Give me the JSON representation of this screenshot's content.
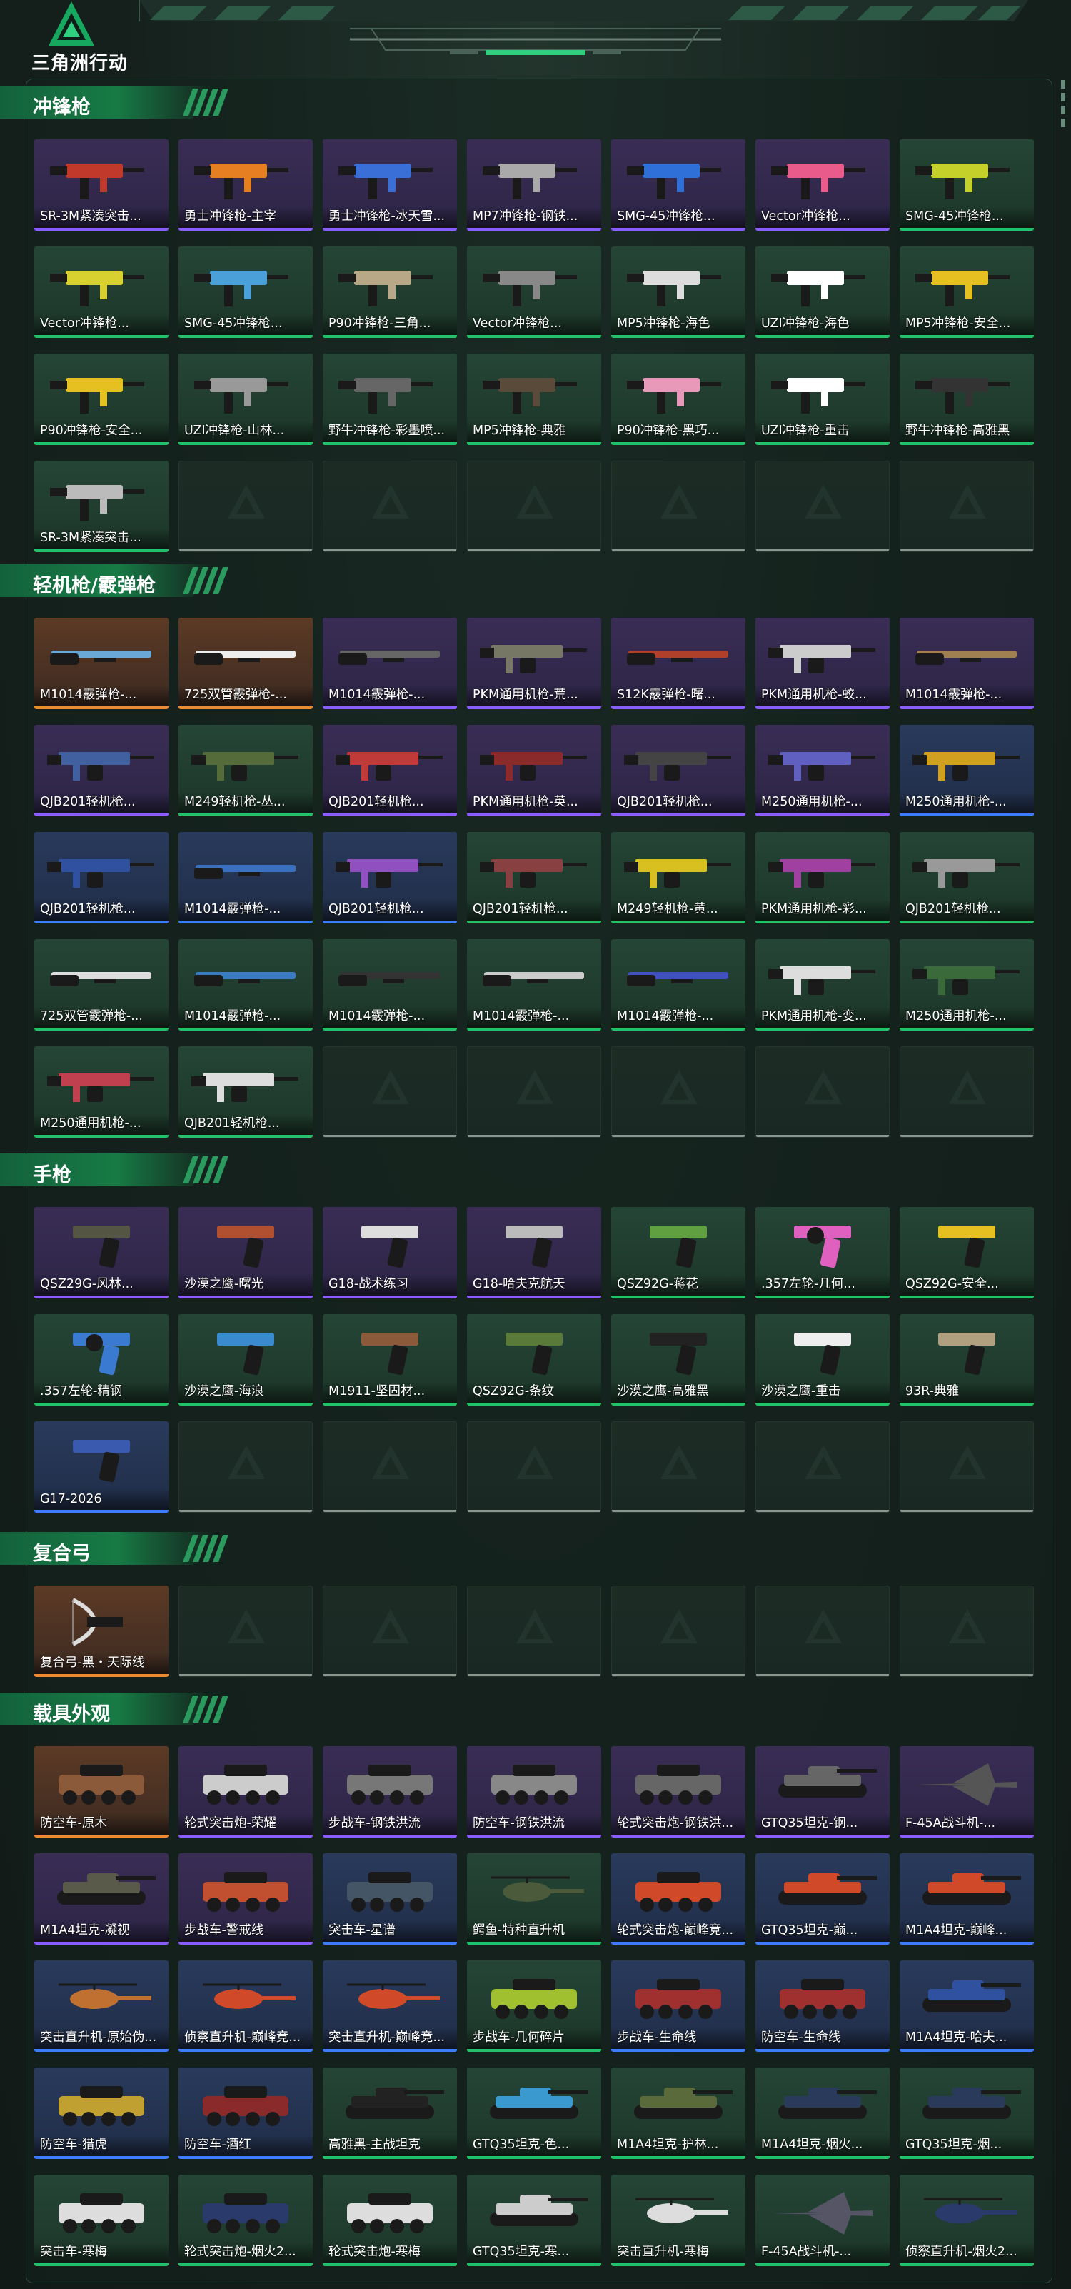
{
  "brand": {
    "name": "三角洲行动",
    "accent": "#22c26a"
  },
  "sections": [
    {
      "title": "冲锋枪",
      "items": [
        {
          "label": "SR-3M紧凑突击...",
          "rarity": "purple",
          "icon": "smg-icon",
          "color": "#c0392b"
        },
        {
          "label": "勇士冲锋枪-主宰",
          "rarity": "purple",
          "icon": "smg-icon",
          "color": "#e67e22"
        },
        {
          "label": "勇士冲锋枪-冰天雪...",
          "rarity": "purple",
          "icon": "smg-icon",
          "color": "#3b6fd8"
        },
        {
          "label": "MP7冲锋枪-钢铁...",
          "rarity": "purple",
          "icon": "smg-icon",
          "color": "#aaaaaa"
        },
        {
          "label": "SMG-45冲锋枪...",
          "rarity": "purple",
          "icon": "smg-icon",
          "color": "#2e6fd8"
        },
        {
          "label": "Vector冲锋枪...",
          "rarity": "purple",
          "icon": "smg-icon",
          "color": "#e85b8a"
        },
        {
          "label": "SMG-45冲锋枪...",
          "rarity": "green",
          "icon": "smg-icon",
          "color": "#c5d02b"
        },
        {
          "label": "Vector冲锋枪...",
          "rarity": "green",
          "icon": "smg-icon",
          "color": "#d8d030"
        },
        {
          "label": "SMG-45冲锋枪...",
          "rarity": "green",
          "icon": "smg-icon",
          "color": "#4aa0d8"
        },
        {
          "label": "P90冲锋枪-三角...",
          "rarity": "green",
          "icon": "smg-icon",
          "color": "#b8a888"
        },
        {
          "label": "Vector冲锋枪...",
          "rarity": "green",
          "icon": "smg-icon",
          "color": "#888888"
        },
        {
          "label": "MP5冲锋枪-海色",
          "rarity": "green",
          "icon": "smg-icon",
          "color": "#dddddd"
        },
        {
          "label": "UZI冲锋枪-海色",
          "rarity": "green",
          "icon": "smg-icon",
          "color": "#ffffff"
        },
        {
          "label": "MP5冲锋枪-安全...",
          "rarity": "green",
          "icon": "smg-icon",
          "color": "#e6c020"
        },
        {
          "label": "P90冲锋枪-安全...",
          "rarity": "green",
          "icon": "smg-icon",
          "color": "#e6c020"
        },
        {
          "label": "UZI冲锋枪-山林...",
          "rarity": "green",
          "icon": "smg-icon",
          "color": "#999999"
        },
        {
          "label": "野牛冲锋枪-彩墨喷...",
          "rarity": "green",
          "icon": "smg-icon",
          "color": "#666666"
        },
        {
          "label": "MP5冲锋枪-典雅",
          "rarity": "green",
          "icon": "smg-icon",
          "color": "#5a4a3a"
        },
        {
          "label": "P90冲锋枪-黑巧...",
          "rarity": "green",
          "icon": "smg-icon",
          "color": "#e898b8"
        },
        {
          "label": "UZI冲锋枪-重击",
          "rarity": "green",
          "icon": "smg-icon",
          "color": "#ffffff"
        },
        {
          "label": "野牛冲锋枪-高雅黑",
          "rarity": "green",
          "icon": "smg-icon",
          "color": "#333333"
        },
        {
          "label": "SR-3M紧凑突击...",
          "rarity": "green",
          "icon": "smg-icon",
          "color": "#bbbbbb"
        },
        {
          "label": "",
          "rarity": "empty"
        },
        {
          "label": "",
          "rarity": "empty"
        },
        {
          "label": "",
          "rarity": "empty"
        },
        {
          "label": "",
          "rarity": "empty"
        },
        {
          "label": "",
          "rarity": "empty"
        },
        {
          "label": "",
          "rarity": "empty"
        }
      ]
    },
    {
      "title": "轻机枪/霰弹枪",
      "items": [
        {
          "label": "M1014霰弹枪-...",
          "rarity": "orange",
          "icon": "shotgun-icon",
          "color": "#6aa8d8"
        },
        {
          "label": "725双管霰弹枪-...",
          "rarity": "orange",
          "icon": "shotgun-icon",
          "color": "#eeeeee"
        },
        {
          "label": "M1014霰弹枪-...",
          "rarity": "purple",
          "icon": "shotgun-icon",
          "color": "#666666"
        },
        {
          "label": "PKM通用机枪-荒...",
          "rarity": "purple",
          "icon": "lmg-icon",
          "color": "#777766"
        },
        {
          "label": "S12K霰弹枪-曙...",
          "rarity": "purple",
          "icon": "shotgun-icon",
          "color": "#b0402a"
        },
        {
          "label": "PKM通用机枪-蛟...",
          "rarity": "purple",
          "icon": "lmg-icon",
          "color": "#cccccc"
        },
        {
          "label": "M1014霰弹枪-...",
          "rarity": "purple",
          "icon": "shotgun-icon",
          "color": "#a08050"
        },
        {
          "label": "QJB201轻机枪...",
          "rarity": "purple",
          "icon": "lmg-icon",
          "color": "#4060a0"
        },
        {
          "label": "M249轻机枪-丛...",
          "rarity": "green",
          "icon": "lmg-icon",
          "color": "#556b3a"
        },
        {
          "label": "QJB201轻机枪...",
          "rarity": "purple",
          "icon": "lmg-icon",
          "color": "#c03a3a"
        },
        {
          "label": "PKM通用机枪-英...",
          "rarity": "purple",
          "icon": "lmg-icon",
          "color": "#8a2a2a"
        },
        {
          "label": "QJB201轻机枪...",
          "rarity": "purple",
          "icon": "lmg-icon",
          "color": "#444444"
        },
        {
          "label": "M250通用机枪-...",
          "rarity": "purple",
          "icon": "lmg-icon",
          "color": "#6060c0"
        },
        {
          "label": "M250通用机枪-...",
          "rarity": "blue",
          "icon": "lmg-icon",
          "color": "#d0a020"
        },
        {
          "label": "QJB201轻机枪...",
          "rarity": "blue",
          "icon": "lmg-icon",
          "color": "#3050a0"
        },
        {
          "label": "M1014霰弹枪-...",
          "rarity": "blue",
          "icon": "shotgun-icon",
          "color": "#3a70c0"
        },
        {
          "label": "QJB201轻机枪...",
          "rarity": "blue",
          "icon": "lmg-icon",
          "color": "#9050c0"
        },
        {
          "label": "QJB201轻机枪...",
          "rarity": "green",
          "icon": "lmg-icon",
          "color": "#884040"
        },
        {
          "label": "M249轻机枪-黄...",
          "rarity": "green",
          "icon": "lmg-icon",
          "color": "#d8c020"
        },
        {
          "label": "PKM通用机枪-彩...",
          "rarity": "green",
          "icon": "lmg-icon",
          "color": "#a040a0"
        },
        {
          "label": "QJB201轻机枪...",
          "rarity": "green",
          "icon": "lmg-icon",
          "color": "#999999"
        },
        {
          "label": "725双管霰弹枪-...",
          "rarity": "green",
          "icon": "shotgun-icon",
          "color": "#dddddd"
        },
        {
          "label": "M1014霰弹枪-...",
          "rarity": "green",
          "icon": "shotgun-icon",
          "color": "#3a7ac0"
        },
        {
          "label": "M1014霰弹枪-...",
          "rarity": "green",
          "icon": "shotgun-icon",
          "color": "#333333"
        },
        {
          "label": "M1014霰弹枪-...",
          "rarity": "green",
          "icon": "shotgun-icon",
          "color": "#cccccc"
        },
        {
          "label": "M1014霰弹枪-...",
          "rarity": "green",
          "icon": "shotgun-icon",
          "color": "#4050c0"
        },
        {
          "label": "PKM通用机枪-变...",
          "rarity": "green",
          "icon": "lmg-icon",
          "color": "#dddddd"
        },
        {
          "label": "M250通用机枪-...",
          "rarity": "green",
          "icon": "lmg-icon",
          "color": "#3a6a3a"
        },
        {
          "label": "M250通用机枪-...",
          "rarity": "green",
          "icon": "lmg-icon",
          "color": "#c04050"
        },
        {
          "label": "QJB201轻机枪...",
          "rarity": "green",
          "icon": "lmg-icon",
          "color": "#dddddd"
        },
        {
          "label": "",
          "rarity": "empty"
        },
        {
          "label": "",
          "rarity": "empty"
        },
        {
          "label": "",
          "rarity": "empty"
        },
        {
          "label": "",
          "rarity": "empty"
        },
        {
          "label": "",
          "rarity": "empty"
        }
      ]
    },
    {
      "title": "手枪",
      "items": [
        {
          "label": "QSZ29G-风林...",
          "rarity": "purple",
          "icon": "pistol-icon",
          "color": "#555544"
        },
        {
          "label": "沙漠之鹰-曙光",
          "rarity": "purple",
          "icon": "pistol-icon",
          "color": "#b05030"
        },
        {
          "label": "G18-战术练习",
          "rarity": "purple",
          "icon": "pistol-icon",
          "color": "#dddddd"
        },
        {
          "label": "G18-哈夫克航天",
          "rarity": "purple",
          "icon": "pistol-icon",
          "color": "#bbbbbb"
        },
        {
          "label": "QSZ92G-蒋花",
          "rarity": "green",
          "icon": "pistol-icon",
          "color": "#60a040"
        },
        {
          "label": ".357左轮-几何...",
          "rarity": "green",
          "icon": "revolver-icon",
          "color": "#e060c0"
        },
        {
          "label": "QSZ92G-安全...",
          "rarity": "green",
          "icon": "pistol-icon",
          "color": "#e6c020"
        },
        {
          "label": ".357左轮-精钢",
          "rarity": "green",
          "icon": "revolver-icon",
          "color": "#3a7ad0"
        },
        {
          "label": "沙漠之鹰-海浪",
          "rarity": "green",
          "icon": "pistol-icon",
          "color": "#3a8ad0"
        },
        {
          "label": "M1911-坚固材...",
          "rarity": "green",
          "icon": "pistol-icon",
          "color": "#8a5a3a"
        },
        {
          "label": "QSZ92G-条纹",
          "rarity": "green",
          "icon": "pistol-icon",
          "color": "#5a7a3a"
        },
        {
          "label": "沙漠之鹰-高雅黑",
          "rarity": "green",
          "icon": "pistol-icon",
          "color": "#222222"
        },
        {
          "label": "沙漠之鹰-重击",
          "rarity": "green",
          "icon": "pistol-icon",
          "color": "#eeeeee"
        },
        {
          "label": "93R-典雅",
          "rarity": "green",
          "icon": "pistol-icon",
          "color": "#b0a080"
        },
        {
          "label": "G17-2026",
          "rarity": "blue",
          "icon": "pistol-icon",
          "color": "#3a5ab0"
        },
        {
          "label": "",
          "rarity": "empty"
        },
        {
          "label": "",
          "rarity": "empty"
        },
        {
          "label": "",
          "rarity": "empty"
        },
        {
          "label": "",
          "rarity": "empty"
        },
        {
          "label": "",
          "rarity": "empty"
        },
        {
          "label": "",
          "rarity": "empty"
        }
      ]
    },
    {
      "title": "复合弓",
      "items": [
        {
          "label": "复合弓-黑・天际线",
          "rarity": "orange",
          "icon": "bow-icon",
          "color": "#dddddd"
        },
        {
          "label": "",
          "rarity": "empty"
        },
        {
          "label": "",
          "rarity": "empty"
        },
        {
          "label": "",
          "rarity": "empty"
        },
        {
          "label": "",
          "rarity": "empty"
        },
        {
          "label": "",
          "rarity": "empty"
        },
        {
          "label": "",
          "rarity": "empty"
        }
      ]
    },
    {
      "title": "载具外观",
      "items": [
        {
          "label": "防空车-原木",
          "rarity": "orange",
          "icon": "vehicle-icon",
          "color": "#8a5a3a"
        },
        {
          "label": "轮式突击炮-荣耀",
          "rarity": "purple",
          "icon": "vehicle-icon",
          "color": "#cccccc"
        },
        {
          "label": "步战车-钢铁洪流",
          "rarity": "purple",
          "icon": "vehicle-icon",
          "color": "#777777"
        },
        {
          "label": "防空车-钢铁洪流",
          "rarity": "purple",
          "icon": "vehicle-icon",
          "color": "#888888"
        },
        {
          "label": "轮式突击炮-钢铁洪...",
          "rarity": "purple",
          "icon": "vehicle-icon",
          "color": "#666666"
        },
        {
          "label": "GTQ35坦克-钢...",
          "rarity": "purple",
          "icon": "tank-icon",
          "color": "#666666"
        },
        {
          "label": "F-45A战斗机-...",
          "rarity": "purple",
          "icon": "jet-icon",
          "color": "#555555"
        },
        {
          "label": "M1A4坦克-凝视",
          "rarity": "purple",
          "icon": "tank-icon",
          "color": "#5a5a4a"
        },
        {
          "label": "步战车-警戒线",
          "rarity": "purple",
          "icon": "vehicle-icon",
          "color": "#c05030"
        },
        {
          "label": "突击车-星谱",
          "rarity": "blue",
          "icon": "vehicle-icon",
          "color": "#445566"
        },
        {
          "label": "鳄鱼-特种直升机",
          "rarity": "green",
          "icon": "helicopter-icon",
          "color": "#4a5a3a"
        },
        {
          "label": "轮式突击炮-巅峰竞...",
          "rarity": "blue",
          "icon": "vehicle-icon",
          "color": "#d04a2a"
        },
        {
          "label": "GTQ35坦克-巅...",
          "rarity": "blue",
          "icon": "tank-icon",
          "color": "#d04a2a"
        },
        {
          "label": "M1A4坦克-巅峰...",
          "rarity": "blue",
          "icon": "tank-icon",
          "color": "#d04a2a"
        },
        {
          "label": "突击直升机-原始伪...",
          "rarity": "blue",
          "icon": "helicopter-icon",
          "color": "#c07030"
        },
        {
          "label": "侦察直升机-巅峰竞...",
          "rarity": "blue",
          "icon": "helicopter-icon",
          "color": "#d04a2a"
        },
        {
          "label": "突击直升机-巅峰竞...",
          "rarity": "blue",
          "icon": "helicopter-icon",
          "color": "#d04a2a"
        },
        {
          "label": "步战车-几何碎片",
          "rarity": "green",
          "icon": "vehicle-icon",
          "color": "#a0c030"
        },
        {
          "label": "步战车-生命线",
          "rarity": "blue",
          "icon": "vehicle-icon",
          "color": "#a03030"
        },
        {
          "label": "防空车-生命线",
          "rarity": "blue",
          "icon": "vehicle-icon",
          "color": "#a03030"
        },
        {
          "label": "M1A4坦克-哈夫...",
          "rarity": "blue",
          "icon": "tank-icon",
          "color": "#3050a0"
        },
        {
          "label": "防空车-猎虎",
          "rarity": "blue",
          "icon": "vehicle-icon",
          "color": "#c0a030"
        },
        {
          "label": "防空车-酒红",
          "rarity": "blue",
          "icon": "vehicle-icon",
          "color": "#8a2a2a"
        },
        {
          "label": "高雅黑-主战坦克",
          "rarity": "green",
          "icon": "tank-icon",
          "color": "#222222"
        },
        {
          "label": "GTQ35坦克-色...",
          "rarity": "green",
          "icon": "tank-icon",
          "color": "#3a9ad0"
        },
        {
          "label": "M1A4坦克-护林...",
          "rarity": "green",
          "icon": "tank-icon",
          "color": "#5a6a3a"
        },
        {
          "label": "M1A4坦克-烟火...",
          "rarity": "green",
          "icon": "tank-icon",
          "color": "#2a3a5a"
        },
        {
          "label": "GTQ35坦克-烟...",
          "rarity": "green",
          "icon": "tank-icon",
          "color": "#2a3a5a"
        },
        {
          "label": "突击车-寒梅",
          "rarity": "green",
          "icon": "vehicle-icon",
          "color": "#dddddd"
        },
        {
          "label": "轮式突击炮-烟火2...",
          "rarity": "green",
          "icon": "vehicle-icon",
          "color": "#2a3a6a"
        },
        {
          "label": "轮式突击炮-寒梅",
          "rarity": "green",
          "icon": "vehicle-icon",
          "color": "#dddddd"
        },
        {
          "label": "GTQ35坦克-寒...",
          "rarity": "green",
          "icon": "tank-icon",
          "color": "#cccccc"
        },
        {
          "label": "突击直升机-寒梅",
          "rarity": "green",
          "icon": "helicopter-icon",
          "color": "#dddddd"
        },
        {
          "label": "F-45A战斗机-...",
          "rarity": "green",
          "icon": "jet-icon",
          "color": "#555566"
        },
        {
          "label": "侦察直升机-烟火2...",
          "rarity": "green",
          "icon": "helicopter-icon",
          "color": "#2a3a6a"
        }
      ]
    }
  ]
}
